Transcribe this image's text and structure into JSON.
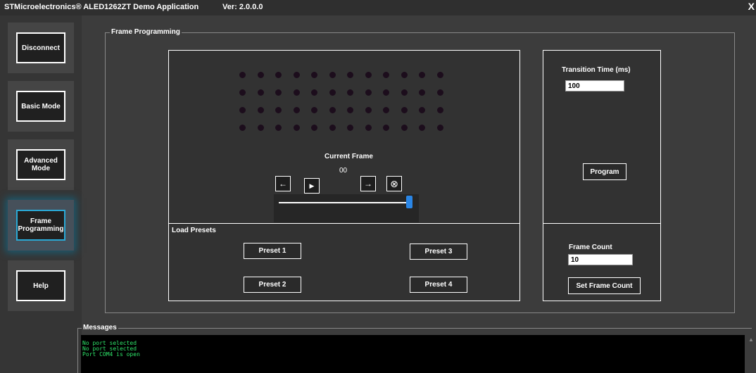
{
  "window": {
    "title": "STMicroelectronics® ALED1262ZT  Demo Application",
    "version": "Ver: 2.0.0.0",
    "close_label": "X"
  },
  "sidebar": {
    "items": [
      {
        "label": "Disconnect"
      },
      {
        "label": "Basic Mode"
      },
      {
        "label": "Advanced\nMode"
      },
      {
        "label": "Frame\nProgramming",
        "active": true
      },
      {
        "label": "Help"
      }
    ]
  },
  "frame_programming": {
    "group_label": "Frame Programming",
    "led_grid": {
      "rows": 4,
      "cols": 12,
      "led_color": "#1c0d1c"
    },
    "current_frame_label": "Current Frame",
    "current_frame_value": "00",
    "controls": {
      "prev_icon": "←",
      "play_icon": "▶",
      "next_icon": "→",
      "clear_icon": "⊗"
    },
    "frame_slider_value": 1.0,
    "load_presets_label": "Load Presets",
    "presets": [
      "Preset 1",
      "Preset 2",
      "Preset 3",
      "Preset 4"
    ],
    "transition_time_label": "Transition Time (ms)",
    "transition_time_value": "100",
    "program_button": "Program",
    "frame_count_label": "Frame Count",
    "frame_count_value": "10",
    "set_frame_count_button": "Set Frame Count"
  },
  "messages": {
    "label": "Messages",
    "lines": [
      "No port selected",
      "No port selected",
      "Port COM4 is open"
    ],
    "text_color": "#2ee56a"
  },
  "colors": {
    "background": "#3c3c3c",
    "active_accent": "#2aa9d6",
    "slider_thumb": "#2a86e6"
  }
}
